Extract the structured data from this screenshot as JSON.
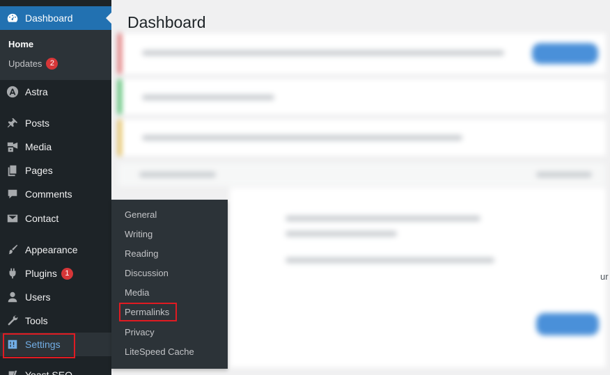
{
  "sidebar": {
    "dashboard": {
      "label": "Dashboard",
      "icon": "dashboard-icon"
    },
    "dashboard_sub": {
      "home": "Home",
      "updates": "Updates",
      "updates_count": "2"
    },
    "items": [
      {
        "id": "astra",
        "label": "Astra",
        "icon": "astra-icon"
      },
      {
        "id": "posts",
        "label": "Posts",
        "icon": "pin-icon"
      },
      {
        "id": "media",
        "label": "Media",
        "icon": "media-icon"
      },
      {
        "id": "pages",
        "label": "Pages",
        "icon": "pages-icon"
      },
      {
        "id": "comments",
        "label": "Comments",
        "icon": "comment-icon"
      },
      {
        "id": "contact",
        "label": "Contact",
        "icon": "mail-icon"
      },
      {
        "id": "appearance",
        "label": "Appearance",
        "icon": "brush-icon"
      },
      {
        "id": "plugins",
        "label": "Plugins",
        "icon": "plugin-icon",
        "badge": "1"
      },
      {
        "id": "users",
        "label": "Users",
        "icon": "user-icon"
      },
      {
        "id": "tools",
        "label": "Tools",
        "icon": "wrench-icon"
      },
      {
        "id": "settings",
        "label": "Settings",
        "icon": "settings-icon"
      },
      {
        "id": "yoast",
        "label": "Yoast SEO",
        "icon": "yoast-icon"
      }
    ]
  },
  "settings_flyout": {
    "items": [
      "General",
      "Writing",
      "Reading",
      "Discussion",
      "Media",
      "Permalinks",
      "Privacy",
      "LiteSpeed Cache"
    ],
    "highlighted": "Permalinks"
  },
  "main": {
    "title": "Dashboard",
    "cut_text": "ur"
  },
  "colors": {
    "sidebar_bg": "#1d2327",
    "submenu_bg": "#2c3338",
    "accent": "#2271b1",
    "highlight_box": "#e01b22",
    "badge": "#d63638"
  }
}
